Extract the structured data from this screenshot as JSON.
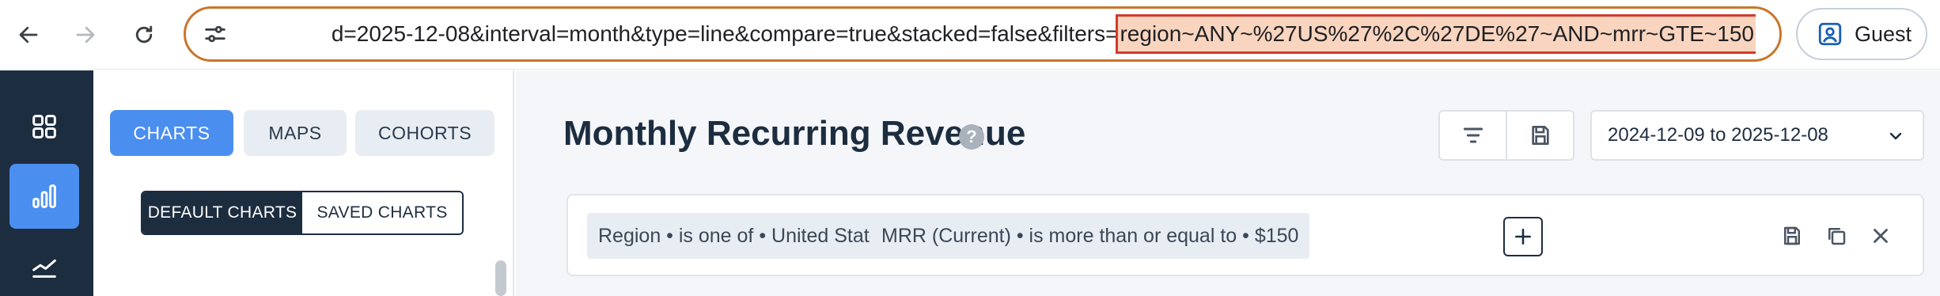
{
  "browser": {
    "url_prefix": "d=2025-12-08&interval=month&type=line&compare=true&stacked=false&filters=",
    "url_highlight": "region~ANY~%27US%27%2C%27DE%27~AND~mrr~GTE~150",
    "profile_label": "Guest",
    "icons": [
      "back-arrow-icon",
      "forward-arrow-icon",
      "reload-icon",
      "site-settings-icon",
      "profile-icon"
    ],
    "highlight_color": "#d33a2c",
    "omnibox_border_color": "#c9762b"
  },
  "rail": {
    "items": [
      {
        "icon": "dashboard-grid-icon",
        "active": false
      },
      {
        "icon": "bar-chart-icon",
        "active": true
      },
      {
        "icon": "trend-line-icon",
        "active": false
      }
    ],
    "background": "#1d2d40",
    "active_color": "#4a8ef0"
  },
  "panel": {
    "tabs": [
      {
        "label": "CHARTS",
        "active": true
      },
      {
        "label": "MAPS",
        "active": false
      },
      {
        "label": "COHORTS",
        "active": false
      }
    ],
    "segments": [
      {
        "label": "DEFAULT CHARTS",
        "active": true
      },
      {
        "label": "SAVED CHARTS",
        "active": false
      }
    ]
  },
  "main": {
    "title": "Monthly Recurring Revenue",
    "help_glyph": "?",
    "date_range": "2024-12-09 to 2025-12-08",
    "filters": [
      "Region • is one of • United States or Germany",
      "MRR (Current) • is more than or equal to • $150"
    ]
  }
}
